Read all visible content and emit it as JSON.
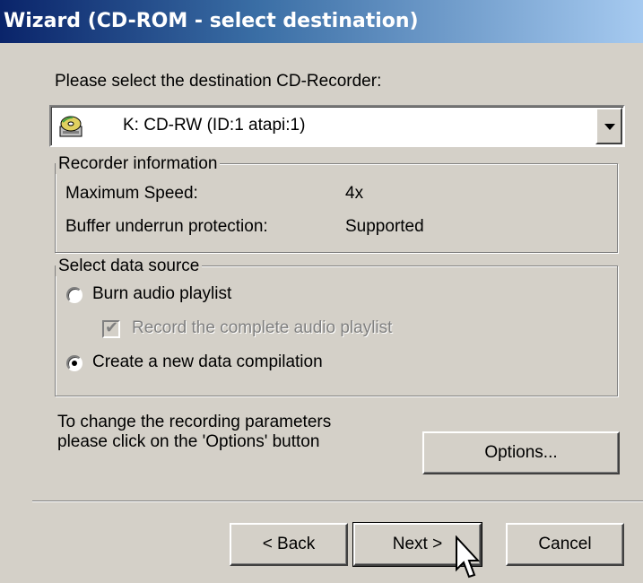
{
  "window": {
    "title": "Wizard (CD-ROM - select destination)"
  },
  "prompt": "Please select the destination CD-Recorder:",
  "recorder_select": {
    "selected": "K: CD-RW (ID:1 atapi:1)",
    "icon": "cd-drive-icon"
  },
  "recorder_info": {
    "legend": "Recorder information",
    "rows": [
      {
        "label": "Maximum Speed:",
        "value": "4x"
      },
      {
        "label": "Buffer underrun protection:",
        "value": "Supported"
      }
    ]
  },
  "data_source": {
    "legend": "Select data source",
    "burn_audio": {
      "label": "Burn audio playlist",
      "selected": false
    },
    "record_complete": {
      "label": "Record the complete audio playlist",
      "checked": true,
      "enabled": false
    },
    "create_data": {
      "label": "Create a new data compilation",
      "selected": true
    }
  },
  "options_hint": {
    "line1": "To change the recording parameters",
    "line2": "please click on the 'Options' button"
  },
  "buttons": {
    "options": "Options...",
    "back": "< Back",
    "next": "Next >",
    "cancel": "Cancel"
  }
}
